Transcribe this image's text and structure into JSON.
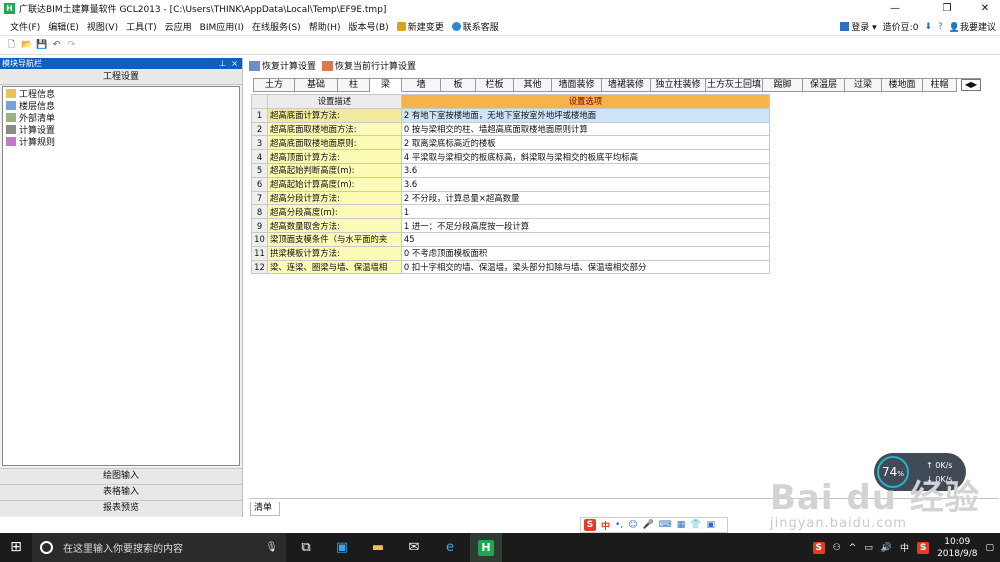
{
  "window": {
    "title": "广联达BIM土建算量软件 GCL2013 - [C:\\Users\\THINK\\AppData\\Local\\Temp\\EF9E.tmp]",
    "app_icon_letter": "H"
  },
  "menubar": {
    "items": [
      "文件(F)",
      "编辑(E)",
      "视图(V)",
      "工具(T)",
      "云应用",
      "BIM应用(I)",
      "在线服务(S)",
      "帮助(H)",
      "版本号(B)",
      "新建变更",
      "联系客服"
    ],
    "right": {
      "login": "登录",
      "price_label": "造价豆:0",
      "suggest": "我要建议"
    }
  },
  "navigator": {
    "title": "模块导航栏",
    "pin": "📌",
    "close": "×",
    "header": "工程设置",
    "tree": [
      "工程信息",
      "楼层信息",
      "外部清单",
      "计算设置",
      "计算规则"
    ],
    "bottom_tabs": [
      "绘图输入",
      "表格输入",
      "报表预览"
    ]
  },
  "main": {
    "actions": [
      "恢复计算设置",
      "恢复当前行计算设置"
    ],
    "tabs": [
      "土方",
      "基础",
      "柱",
      "梁",
      "墙",
      "板",
      "栏板",
      "其他",
      "墙面装修",
      "墙裙装修",
      "独立柱装修",
      "土方灰土回填",
      "踢脚",
      "保温层",
      "过梁",
      "楼地面",
      "柱帽"
    ],
    "active_tab": "梁",
    "columns": {
      "desc": "设置描述",
      "option": "设置选项"
    },
    "rows": [
      {
        "n": "1",
        "desc": "超高底面计算方法:",
        "opt": "2 有地下室按楼地面，无地下室按室外地坪或楼地面"
      },
      {
        "n": "2",
        "desc": "超高底面取楼地面方法:",
        "opt": "0 按与梁相交的柱、墙超高底面取楼地面原则计算"
      },
      {
        "n": "3",
        "desc": "超高底面取楼地面原则:",
        "opt": "2 取离梁底标高近的楼板"
      },
      {
        "n": "4",
        "desc": "超高顶面计算方法:",
        "opt": "4 平梁取与梁相交的板底标高，斜梁取与梁相交的板底平均标高"
      },
      {
        "n": "5",
        "desc": "超高起始判断高度(m):",
        "opt": "3.6"
      },
      {
        "n": "6",
        "desc": "超高起始计算高度(m):",
        "opt": "3.6"
      },
      {
        "n": "7",
        "desc": "超高分段计算方法:",
        "opt": "2 不分段，计算总量×超高数量"
      },
      {
        "n": "8",
        "desc": "超高分段高度(m):",
        "opt": "1"
      },
      {
        "n": "9",
        "desc": "超高数量取舍方法:",
        "opt": "1 进一：不足分段高度按一段计算"
      },
      {
        "n": "10",
        "desc": "梁顶面支模条件（与水平面的夹",
        "opt": "45"
      },
      {
        "n": "11",
        "desc": "拱梁模板计算方法:",
        "opt": "0 不考虑顶面模板面积"
      },
      {
        "n": "12",
        "desc": "梁、连梁、圈梁与墙、保温墙相",
        "opt": "0 扣十字相交的墙、保温墙，梁头部分扣除与墙、保温墙相交部分"
      }
    ],
    "bottom_tab": "清单"
  },
  "ime": {
    "s": "S",
    "lang": "中",
    "dots": "•,",
    "emoji": "☺",
    "mic": "🎤",
    "kbd": "⌨",
    "grid": "▦",
    "shirt": "👕",
    "tools": "▣"
  },
  "speed_widget": {
    "percent": "74",
    "unit": "%",
    "up": "0K/s",
    "down": "0K/s"
  },
  "watermark": {
    "text": "Bai du 经验",
    "url": "jingyan.baidu.com"
  },
  "taskbar": {
    "search_placeholder": "在这里输入你要搜索的内容",
    "tray_lang": "中",
    "time": "10:09",
    "date": "2018/9/8"
  }
}
